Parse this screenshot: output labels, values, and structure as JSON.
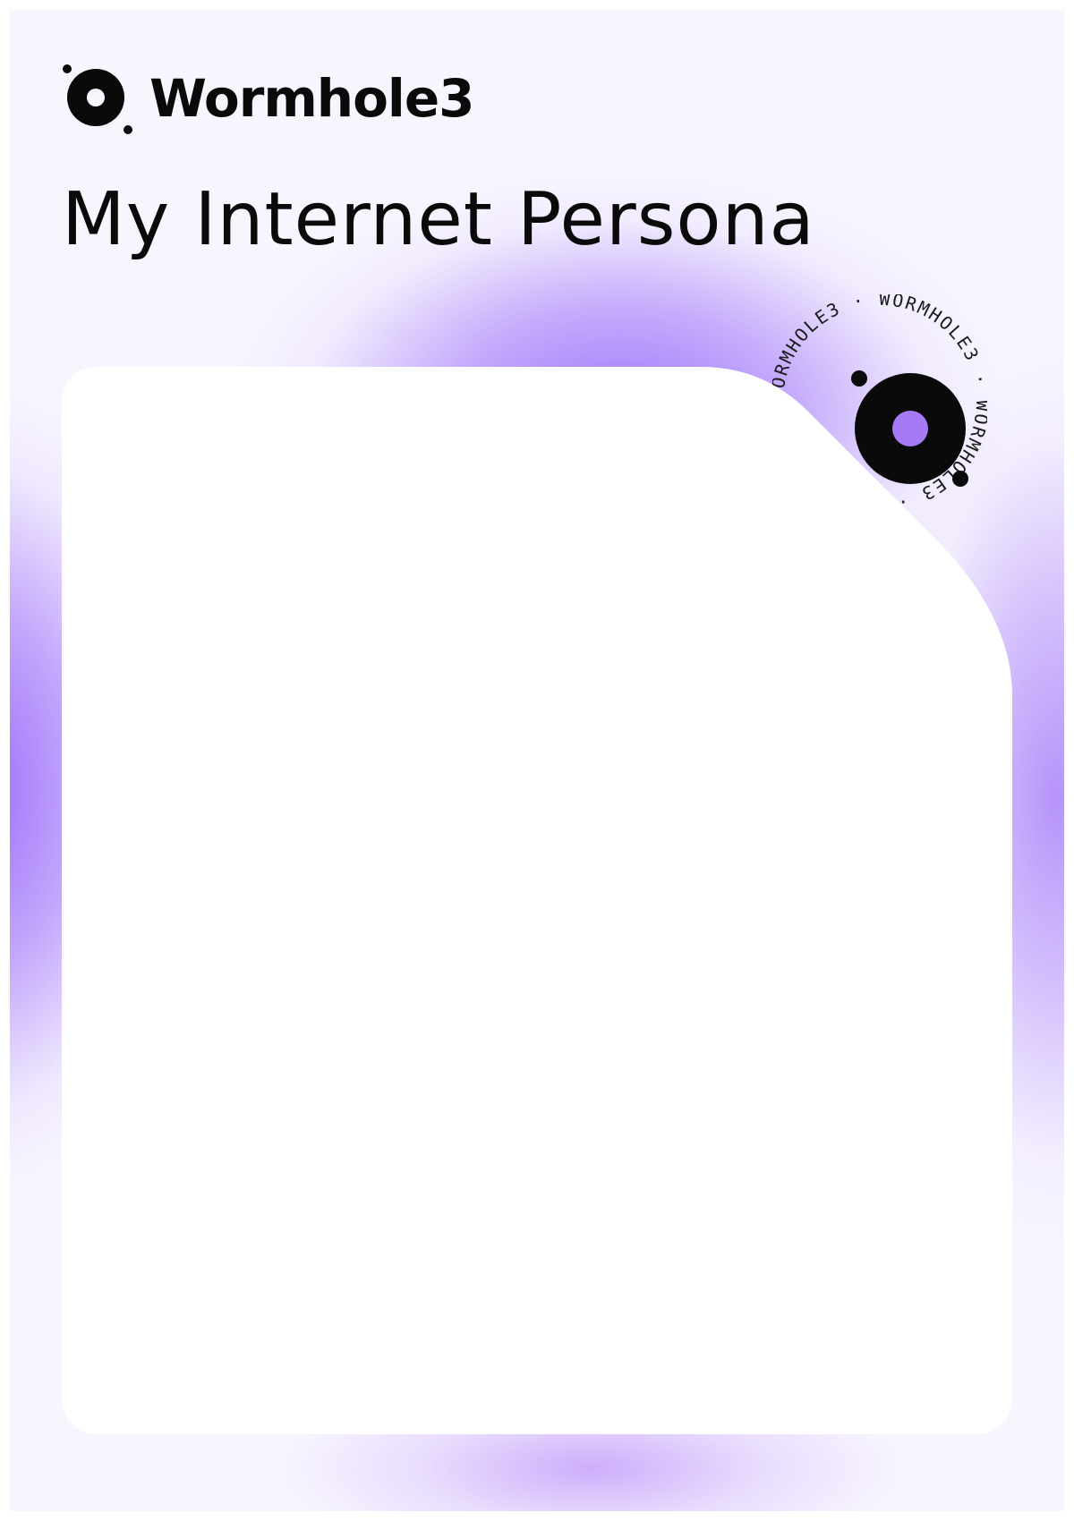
{
  "brand": {
    "name": "Wormhole3",
    "icon": "wormhole-logo-icon",
    "accent_color": "#9b6cf7",
    "text_color": "#0a0a0a"
  },
  "page": {
    "title": "My Internet Persona",
    "background_color": "#f8f5fe"
  },
  "seal": {
    "ring_text": "WORMHOLE3 · WORMHOLE3 · WORMHOLE3 ·",
    "icon": "wormhole-seal-icon"
  },
  "photo_frame": {
    "icon": "photo-placeholder-card",
    "fill_color": "#ffffff"
  }
}
